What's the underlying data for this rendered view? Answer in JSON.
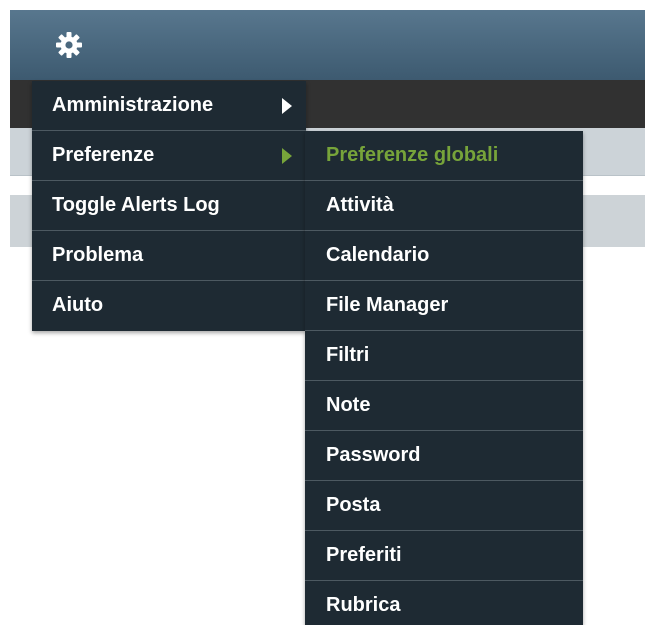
{
  "toolbar": {
    "settings_icon": "gear-icon"
  },
  "main_menu": {
    "items": [
      {
        "label": "Amministrazione",
        "has_submenu": true
      },
      {
        "label": "Preferenze",
        "has_submenu": true,
        "expanded": true
      },
      {
        "label": "Toggle Alerts Log"
      },
      {
        "label": "Problema"
      },
      {
        "label": "Aiuto"
      }
    ]
  },
  "sub_menu": {
    "items": [
      {
        "label": "Preferenze globali",
        "highlighted": true
      },
      {
        "label": "Attività"
      },
      {
        "label": "Calendario"
      },
      {
        "label": "File Manager"
      },
      {
        "label": "Filtri"
      },
      {
        "label": "Note"
      },
      {
        "label": "Password"
      },
      {
        "label": "Posta"
      },
      {
        "label": "Preferiti"
      },
      {
        "label": "Rubrica"
      }
    ]
  },
  "colors": {
    "toolbar": "#4b687e",
    "menu_bg": "#1e2a33",
    "highlight": "#77a43a",
    "divider": "#4d5961"
  }
}
